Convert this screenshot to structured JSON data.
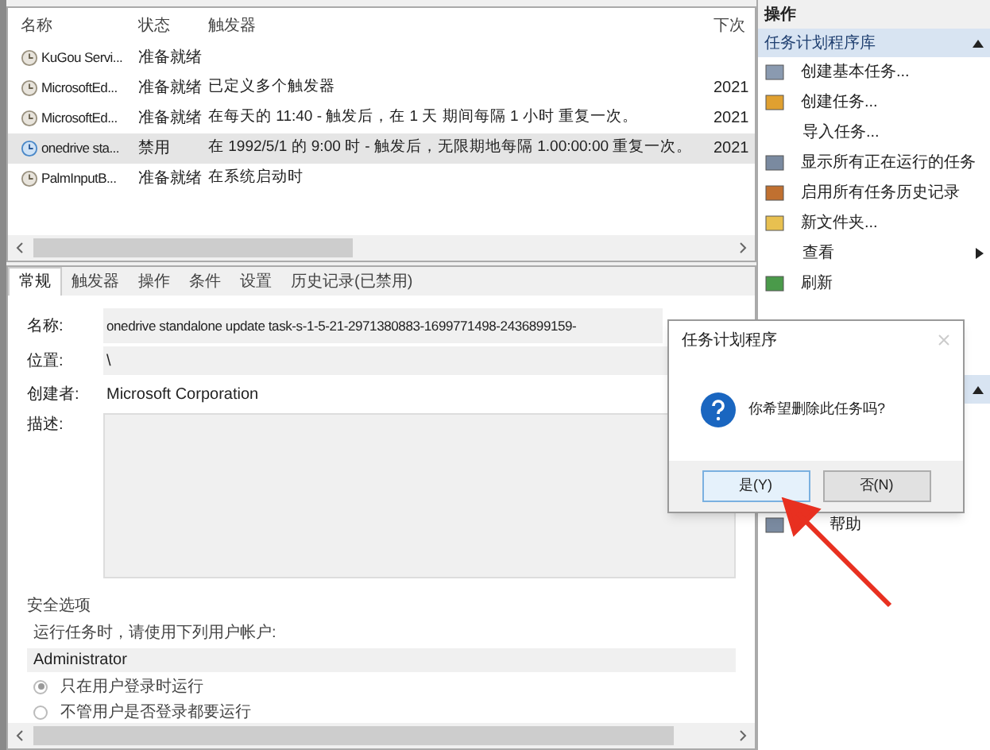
{
  "task_list": {
    "columns": [
      "名称",
      "状态",
      "触发器",
      "下次"
    ],
    "rows": [
      {
        "name": "KuGou Servi...",
        "status": "准备就绪",
        "trigger": "",
        "next": "",
        "selected": false,
        "enabled": true
      },
      {
        "name": "MicrosoftEd...",
        "status": "准备就绪",
        "trigger": "已定义多个触发器",
        "next": "2021",
        "selected": false,
        "enabled": true
      },
      {
        "name": "MicrosoftEd...",
        "status": "准备就绪",
        "trigger": "在每天的 11:40 - 触发后，在 1 天 期间每隔 1 小时 重复一次。",
        "next": "2021",
        "selected": false,
        "enabled": true
      },
      {
        "name": "onedrive sta...",
        "status": "禁用",
        "trigger": "在 1992/5/1 的 9:00 时 - 触发后，无限期地每隔 1.00:00:00 重复一次。",
        "next": "2021",
        "selected": true,
        "enabled": false
      },
      {
        "name": "PalmInputB...",
        "status": "准备就绪",
        "trigger": "在系统启动时",
        "next": "",
        "selected": false,
        "enabled": true
      }
    ]
  },
  "detail_tabs": [
    {
      "label": "常规",
      "selected": true
    },
    {
      "label": "触发器",
      "selected": false
    },
    {
      "label": "操作",
      "selected": false
    },
    {
      "label": "条件",
      "selected": false
    },
    {
      "label": "设置",
      "selected": false
    },
    {
      "label": "历史记录(已禁用)",
      "selected": false
    }
  ],
  "general": {
    "name_label": "名称:",
    "name_value": "onedrive standalone update task-s-1-5-21-2971380883-1699771498-2436899159-",
    "location_label": "位置:",
    "location_value": "\\",
    "author_label": "创建者:",
    "author_value": "Microsoft Corporation",
    "description_label": "描述:",
    "security_title": "安全选项",
    "run_as_label": "运行任务时，请使用下列用户帐户:",
    "run_as_value": "Administrator",
    "options": [
      {
        "label": "只在用户登录时运行",
        "selected": true
      },
      {
        "label": "不管用户是否登录都要运行",
        "selected": false
      }
    ]
  },
  "actions_panel": {
    "title": "操作",
    "section": "任务计划程序库",
    "items": [
      {
        "label": "创建基本任务...",
        "kind": "wizard",
        "submenu": false
      },
      {
        "label": "创建任务...",
        "kind": "task",
        "submenu": false
      },
      {
        "label": "导入任务...",
        "kind": "plain",
        "submenu": false
      },
      {
        "label": "显示所有正在运行的任务",
        "kind": "list",
        "submenu": false
      },
      {
        "label": "启用所有任务历史记录",
        "kind": "history",
        "submenu": false
      },
      {
        "label": "新文件夹...",
        "kind": "folder",
        "submenu": false
      },
      {
        "label": "查看",
        "kind": "plain",
        "submenu": true
      },
      {
        "label": "刷新",
        "kind": "refresh",
        "submenu": false
      }
    ],
    "help_label": "帮助"
  },
  "dialog": {
    "title": "任务计划程序",
    "message": "你希望删除此任务吗?",
    "buttons": [
      {
        "label": "是(Y)",
        "selected": true
      },
      {
        "label": "否(N)",
        "selected": false
      }
    ]
  }
}
